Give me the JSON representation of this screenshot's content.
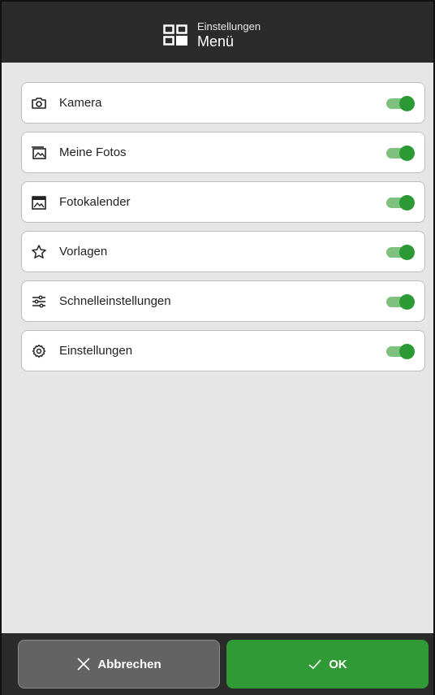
{
  "header": {
    "subtitle": "Einstellungen",
    "title": "Menü",
    "icon": "grid-icon"
  },
  "items": [
    {
      "label": "Kamera",
      "icon": "camera-icon",
      "enabled": true
    },
    {
      "label": "Meine Fotos",
      "icon": "photos-icon",
      "enabled": true
    },
    {
      "label": "Fotokalender",
      "icon": "calendar-photo-icon",
      "enabled": true
    },
    {
      "label": "Vorlagen",
      "icon": "star-icon",
      "enabled": true
    },
    {
      "label": "Schnelleinstellungen",
      "icon": "sliders-icon",
      "enabled": true
    },
    {
      "label": "Einstellungen",
      "icon": "gear-icon",
      "enabled": true
    }
  ],
  "footer": {
    "cancel_label": "Abbrechen",
    "ok_label": "OK"
  },
  "colors": {
    "header_bg": "#2b2b2b",
    "accent_green": "#2c9a34",
    "toggle_track": "#7ec07e",
    "cancel_bg": "#636363"
  }
}
